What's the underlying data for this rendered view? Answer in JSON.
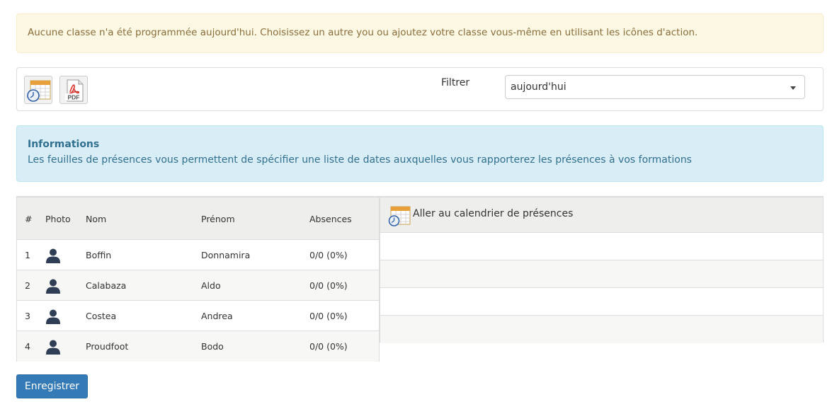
{
  "alert": {
    "message": "Aucune classe n'a été programmée aujourd'hui. Choisissez un autre you ou ajoutez votre classe vous-même en utilisant les icônes d'action."
  },
  "toolbar": {
    "calendar_icon": "calendar-clock-icon",
    "pdf_icon": "pdf-icon",
    "pdf_text": "PDF",
    "filter_label": "Filtrer",
    "filter_value": "aujourd'hui"
  },
  "info": {
    "title": "Informations",
    "text": "Les feuilles de présences vous permettent de spécifier une liste de dates auxquelles vous rapporterez les présences à vos formations"
  },
  "students": {
    "headers": [
      "#",
      "Photo",
      "Nom",
      "Prénom",
      "Absences"
    ],
    "rows": [
      {
        "num": "1",
        "nom": "Boffin",
        "prenom": "Donnamira",
        "absences": "0/0 (0%)"
      },
      {
        "num": "2",
        "nom": "Calabaza",
        "prenom": "Aldo",
        "absences": "0/0 (0%)"
      },
      {
        "num": "3",
        "nom": "Costea",
        "prenom": "Andrea",
        "absences": "0/0 (0%)"
      },
      {
        "num": "4",
        "nom": "Proudfoot",
        "prenom": "Bodo",
        "absences": "0/0 (0%)"
      }
    ]
  },
  "calendar": {
    "link_label": "Aller au calendrier de présences"
  },
  "actions": {
    "save_label": "Enregistrer"
  },
  "colors": {
    "primary": "#337ab7",
    "warning_bg": "#fcf8e3",
    "info_bg": "#d9edf7",
    "avatar": "#2f3e55"
  }
}
